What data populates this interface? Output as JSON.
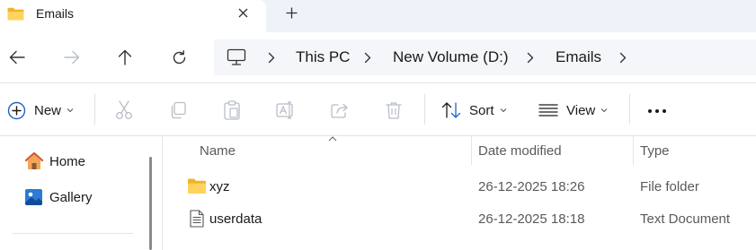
{
  "tab": {
    "title": "Emails",
    "close_glyph": "✕",
    "new_tab_glyph": "+"
  },
  "nav": {
    "back_icon": "arrow-left-icon",
    "forward_icon": "arrow-right-icon",
    "up_icon": "arrow-up-icon",
    "refresh_icon": "refresh-icon"
  },
  "address": {
    "root_icon": "computer-icon",
    "crumbs": [
      "This PC",
      "New Volume (D:)",
      "Emails"
    ],
    "separator": "›"
  },
  "toolbar": {
    "new_label": "New",
    "sort_label": "Sort",
    "view_label": "View",
    "more_glyph": "•••",
    "icons": [
      "cut-icon",
      "copy-icon",
      "paste-icon",
      "rename-icon",
      "share-icon",
      "delete-icon"
    ]
  },
  "sidebar": {
    "items": [
      {
        "label": "Home",
        "icon": "home-icon"
      },
      {
        "label": "Gallery",
        "icon": "gallery-icon"
      }
    ]
  },
  "list": {
    "columns": {
      "name": "Name",
      "date": "Date modified",
      "type": "Type"
    },
    "rows": [
      {
        "name": "xyz",
        "date": "26-12-2025 18:26",
        "type": "File folder",
        "icon": "folder-icon"
      },
      {
        "name": "userdata",
        "date": "26-12-2025 18:18",
        "type": "Text Document",
        "icon": "text-file-icon"
      }
    ]
  },
  "colors": {
    "folder_yellow": "#f5c342",
    "accent_blue": "#1f63c6",
    "disabled_icon": "#b8bec7",
    "address_bg": "#f4f6fa"
  }
}
